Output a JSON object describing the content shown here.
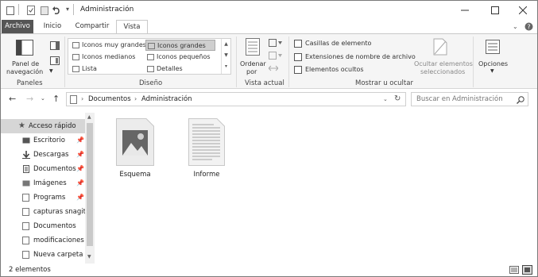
{
  "window": {
    "title": "Administración"
  },
  "tabs": [
    {
      "label": "Archivo"
    },
    {
      "label": "Inicio"
    },
    {
      "label": "Compartir"
    },
    {
      "label": "Vista"
    }
  ],
  "ribbon": {
    "panes": {
      "nav_pane_line1": "Panel de",
      "nav_pane_line2": "navegación",
      "group": "Paneles"
    },
    "layout": {
      "items": [
        {
          "label": "Iconos muy grandes"
        },
        {
          "label": "Iconos grandes"
        },
        {
          "label": "Iconos medianos"
        },
        {
          "label": "Iconos pequeños"
        },
        {
          "label": "Lista"
        },
        {
          "label": "Detalles"
        }
      ],
      "group": "Diseño"
    },
    "current_view": {
      "sort_line1": "Ordenar",
      "sort_line2": "por",
      "group": "Vista actual"
    },
    "show_hide": {
      "checkboxes": [
        {
          "label": "Casillas de elemento",
          "checked": false
        },
        {
          "label": "Extensiones de nombre de archivo",
          "checked": false
        },
        {
          "label": "Elementos ocultos",
          "checked": false
        }
      ],
      "hide_selected_line1": "Ocultar elementos",
      "hide_selected_line2": "seleccionados",
      "group": "Mostrar u ocultar"
    },
    "options": {
      "label": "Opciones"
    }
  },
  "address": {
    "crumbs": [
      "Documentos",
      "Administración"
    ],
    "search_placeholder": "Buscar en Administración"
  },
  "nav_pane": {
    "items": [
      {
        "label": "Acceso rápido",
        "icon": "star-icon",
        "pinned": false,
        "selected": true
      },
      {
        "label": "Escritorio",
        "icon": "desktop-icon",
        "pinned": true
      },
      {
        "label": "Descargas",
        "icon": "download-icon",
        "pinned": true
      },
      {
        "label": "Documentos",
        "icon": "documents-icon",
        "pinned": true
      },
      {
        "label": "Imágenes",
        "icon": "pictures-icon",
        "pinned": true
      },
      {
        "label": "Programs",
        "icon": "folder-icon",
        "pinned": true
      },
      {
        "label": "capturas snagit",
        "icon": "folder-icon",
        "pinned": false
      },
      {
        "label": "Documentos",
        "icon": "folder-icon",
        "pinned": false
      },
      {
        "label": "modificaciones r",
        "icon": "folder-icon",
        "pinned": false
      },
      {
        "label": "Nueva carpeta",
        "icon": "folder-icon",
        "pinned": false
      }
    ]
  },
  "files": [
    {
      "name": "Esquema",
      "icon": "image-file-icon"
    },
    {
      "name": "Informe",
      "icon": "text-document-icon"
    }
  ],
  "status": {
    "count": "2 elementos"
  }
}
